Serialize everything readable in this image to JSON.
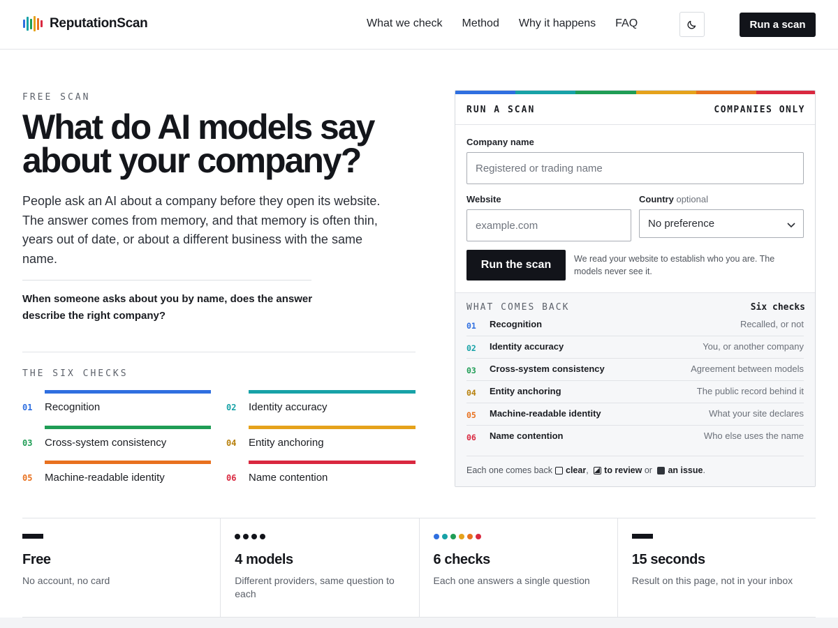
{
  "brand": {
    "name": "ReputationScan",
    "mark_colors": [
      "#2f6fe0",
      "#17a2a7",
      "#1f9d55",
      "#e5a21b",
      "#e8711f",
      "#d9283f"
    ]
  },
  "nav": {
    "items": [
      "What we check",
      "Method",
      "Why it happens",
      "FAQ"
    ],
    "cta": "Run a scan"
  },
  "hero": {
    "eyebrow": "FREE SCAN",
    "title": "What do AI models say about your company?",
    "body": "People ask an AI about a company before they open its website. The answer comes from memory, and that memory is often thin, years out of date, or about a different business with the same name.",
    "question": "When someone asks about you by name, does the answer describe the right company?"
  },
  "checks": {
    "label": "THE SIX CHECKS",
    "items": [
      {
        "num": "01",
        "name": "Recognition",
        "color": "#2f6fe0"
      },
      {
        "num": "02",
        "name": "Identity accuracy",
        "color": "#17a2a7"
      },
      {
        "num": "03",
        "name": "Cross-system consistency",
        "color": "#1f9d55"
      },
      {
        "num": "04",
        "name": "Entity anchoring",
        "color": "#e5a21b"
      },
      {
        "num": "05",
        "name": "Machine-readable identity",
        "color": "#e8711f"
      },
      {
        "num": "06",
        "name": "Name contention",
        "color": "#d9283f"
      }
    ]
  },
  "scan": {
    "title": "RUN A SCAN",
    "tag": "COMPANIES ONLY",
    "company_label": "Company name",
    "company_placeholder": "Registered or trading name",
    "website_label": "Website",
    "website_placeholder": "example.com",
    "country_label": "Country",
    "country_optional": "optional",
    "country_value": "No preference",
    "button": "Run the scan",
    "note": "We read your website to establish who you are. The models never see it."
  },
  "returns": {
    "label": "WHAT COMES BACK",
    "count": "Six checks",
    "rows": [
      {
        "num": "01",
        "name": "Recognition",
        "desc": "Recalled, or not"
      },
      {
        "num": "02",
        "name": "Identity accuracy",
        "desc": "You, or another company"
      },
      {
        "num": "03",
        "name": "Cross-system consistency",
        "desc": "Agreement between models"
      },
      {
        "num": "04",
        "name": "Entity anchoring",
        "desc": "The public record behind it"
      },
      {
        "num": "05",
        "name": "Machine-readable identity",
        "desc": "What your site declares"
      },
      {
        "num": "06",
        "name": "Name contention",
        "desc": "Who else uses the name"
      }
    ],
    "legend": {
      "prefix": "Each one comes back",
      "clear": "clear",
      "review": "to review",
      "or": "or",
      "issue": "an issue",
      "end": "."
    }
  },
  "stats": [
    {
      "title": "Free",
      "desc": "No account, no card"
    },
    {
      "title": "4 models",
      "desc": "Different providers, same question to each"
    },
    {
      "title": "6 checks",
      "desc": "Each one answers a single question"
    },
    {
      "title": "15 seconds",
      "desc": "Result on this page, not in your inbox"
    }
  ]
}
